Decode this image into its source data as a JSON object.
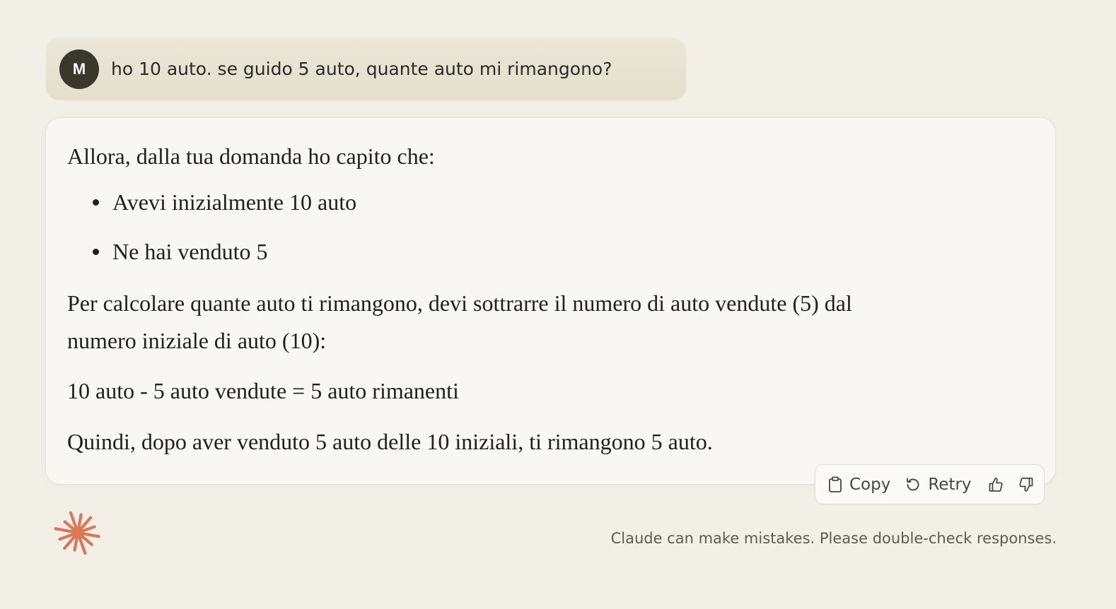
{
  "user_message": {
    "avatar_initial": "M",
    "text": "ho 10 auto. se guido 5 auto, quante auto mi rimangono?"
  },
  "assistant_message": {
    "intro": "Allora, dalla tua domanda ho capito che:",
    "bullets": [
      "Avevi inizialmente 10 auto",
      "Ne hai venduto 5"
    ],
    "paragraph_line1": "Per calcolare quante auto ti rimangono, devi sottrarre il numero di auto vendute (5) dal",
    "paragraph_line2": "numero iniziale di auto (10):",
    "equation": "10 auto - 5 auto vendute = 5 auto rimanenti",
    "conclusion": "Quindi, dopo aver venduto 5 auto delle 10 iniziali, ti rimangono 5 auto."
  },
  "actions": {
    "copy_label": "Copy",
    "copy_icon": "clipboard-icon",
    "retry_label": "Retry",
    "retry_icon": "retry-icon",
    "thumbs_up_icon": "thumbs-up-icon",
    "thumbs_down_icon": "thumbs-down-icon"
  },
  "footer": {
    "disclaimer": "Claude can make mistakes. Please double-check responses."
  },
  "colors": {
    "background": "#f2efe7",
    "user_bubble": "#e7e3d3",
    "avatar": "#3a372c",
    "card": "#f8f7f3",
    "logo_accent": "#d97757"
  }
}
